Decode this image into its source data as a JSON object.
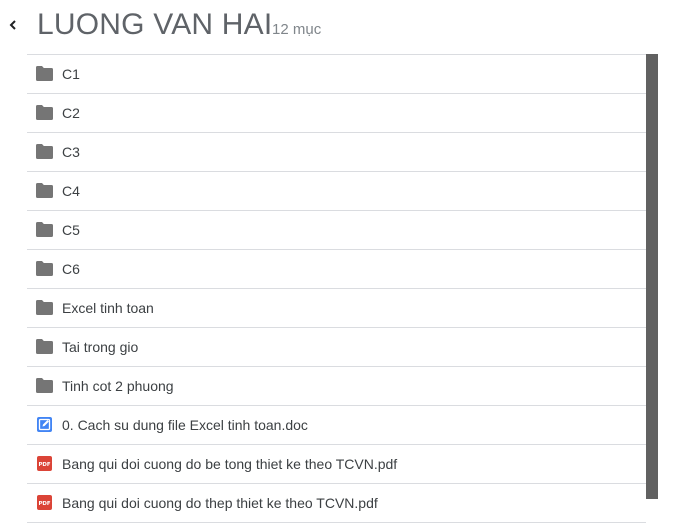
{
  "header": {
    "title": "LUONG VAN HAI",
    "count": "12 mục",
    "back_icon": "chevron-left-icon"
  },
  "items": [
    {
      "label": "C1",
      "type": "folder",
      "icon": "folder-icon"
    },
    {
      "label": "C2",
      "type": "folder",
      "icon": "folder-icon"
    },
    {
      "label": "C3",
      "type": "folder",
      "icon": "folder-icon"
    },
    {
      "label": "C4",
      "type": "folder",
      "icon": "folder-icon"
    },
    {
      "label": "C5",
      "type": "folder",
      "icon": "folder-icon"
    },
    {
      "label": "C6",
      "type": "folder",
      "icon": "folder-icon"
    },
    {
      "label": "Excel tinh toan",
      "type": "folder",
      "icon": "folder-icon"
    },
    {
      "label": "Tai trong gio",
      "type": "folder",
      "icon": "folder-icon"
    },
    {
      "label": "Tinh cot 2 phuong",
      "type": "folder",
      "icon": "folder-icon"
    },
    {
      "label": "0. Cach su dung file Excel tinh toan.doc",
      "type": "doc",
      "icon": "doc-file-icon"
    },
    {
      "label": "Bang qui doi cuong do be tong thiet ke theo TCVN.pdf",
      "type": "pdf",
      "icon": "pdf-file-icon"
    },
    {
      "label": "Bang qui doi cuong do thep thiet ke theo TCVN.pdf",
      "type": "pdf",
      "icon": "pdf-file-icon"
    }
  ],
  "colors": {
    "folder": "#757575",
    "doc": "#4285f4",
    "pdf": "#db4437",
    "divider": "#dadce0",
    "scrollbar": "#616161"
  }
}
